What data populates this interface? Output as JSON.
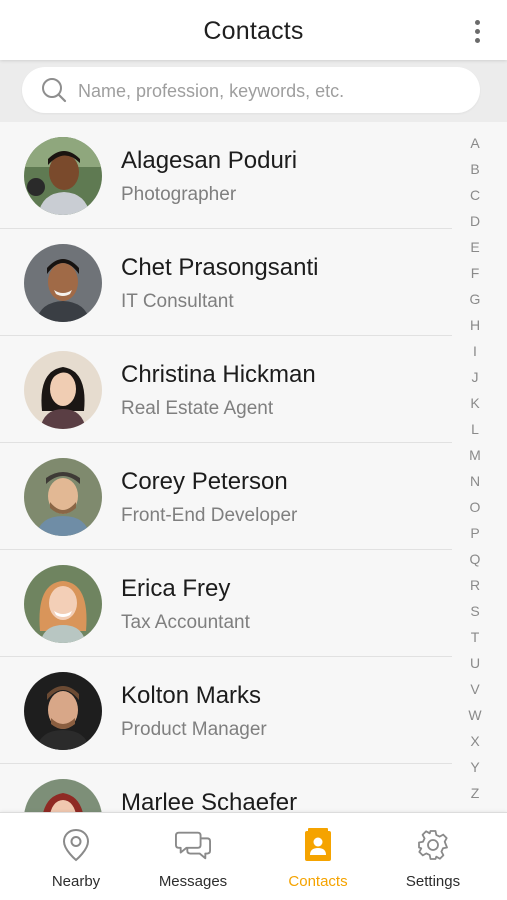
{
  "header": {
    "title": "Contacts",
    "more_icon": "more-vertical-icon"
  },
  "search": {
    "placeholder": "Name, profession, keywords, etc.",
    "value": "",
    "icon": "search-icon"
  },
  "contacts": [
    {
      "name": "Alagesan Poduri",
      "role": "Photographer"
    },
    {
      "name": "Chet Prasongsanti",
      "role": "IT Consultant"
    },
    {
      "name": "Christina Hickman",
      "role": "Real Estate Agent"
    },
    {
      "name": "Corey Peterson",
      "role": "Front-End Developer"
    },
    {
      "name": "Erica Frey",
      "role": "Tax Accountant"
    },
    {
      "name": "Kolton Marks",
      "role": "Product Manager"
    },
    {
      "name": "Marlee Schaefer",
      "role": ""
    }
  ],
  "alphabet": [
    "A",
    "B",
    "C",
    "D",
    "E",
    "F",
    "G",
    "H",
    "I",
    "J",
    "K",
    "L",
    "M",
    "N",
    "O",
    "P",
    "Q",
    "R",
    "S",
    "T",
    "U",
    "V",
    "W",
    "X",
    "Y",
    "Z"
  ],
  "tabs": [
    {
      "label": "Nearby",
      "icon": "map-pin-icon",
      "active": false
    },
    {
      "label": "Messages",
      "icon": "chat-bubbles-icon",
      "active": false
    },
    {
      "label": "Contacts",
      "icon": "contacts-book-icon",
      "active": true
    },
    {
      "label": "Settings",
      "icon": "gear-icon",
      "active": false
    }
  ],
  "colors": {
    "accent": "#f5a300",
    "icon_gray": "#8a8a8a",
    "text_dark": "#1c1c1c",
    "text_muted": "#7f7f7f"
  }
}
